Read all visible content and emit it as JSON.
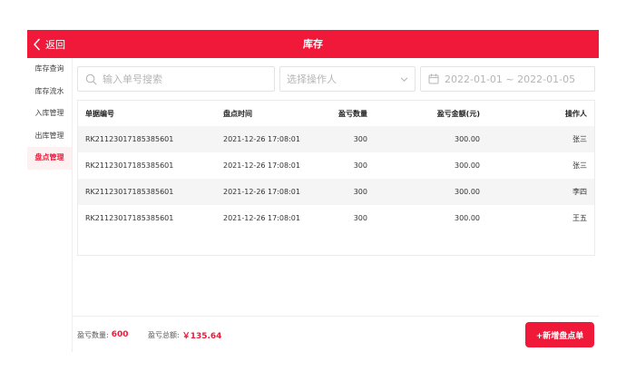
{
  "header": {
    "back_label": "返回",
    "title": "库存"
  },
  "sidebar": {
    "items": [
      {
        "label": "库存查询",
        "active": false
      },
      {
        "label": "库存流水",
        "active": false
      },
      {
        "label": "入库管理",
        "active": false
      },
      {
        "label": "出库管理",
        "active": false
      },
      {
        "label": "盘点管理",
        "active": true
      }
    ]
  },
  "filters": {
    "search_placeholder": "输入单号搜索",
    "search_value": "",
    "operator_placeholder": "选择操作人",
    "date_range": "2022-01-01 ~ 2022-01-05"
  },
  "table": {
    "columns": [
      "单据编号",
      "盘点时间",
      "盈亏数量",
      "盈亏金额(元)",
      "操作人"
    ],
    "rows": [
      {
        "id": "RK2112301718538560​1",
        "time": "2021-12-26 17:08:01",
        "qty": "300",
        "amount": "300.00",
        "operator": "张三"
      },
      {
        "id": "RK21123017185385601",
        "time": "2021-12-26 17:08:01",
        "qty": "300",
        "amount": "300.00",
        "operator": "张三"
      },
      {
        "id": "RK21123017185385601",
        "time": "2021-12-26 17:08:01",
        "qty": "300",
        "amount": "300.00",
        "operator": "李四"
      },
      {
        "id": "RK21123017185385601",
        "time": "2021-12-26 17:08:01",
        "qty": "300",
        "amount": "300.00",
        "operator": "王五"
      }
    ]
  },
  "footer": {
    "qty_label": "盈亏数量:",
    "qty_value": "600",
    "amount_label": "盈亏总额:",
    "amount_value": "￥135.64",
    "add_button": "+新增盘点单"
  },
  "colors": {
    "brand": "#f0193a",
    "sidebar_active_bg": "#fdf1f2",
    "stripe": "#f5f5f5"
  }
}
